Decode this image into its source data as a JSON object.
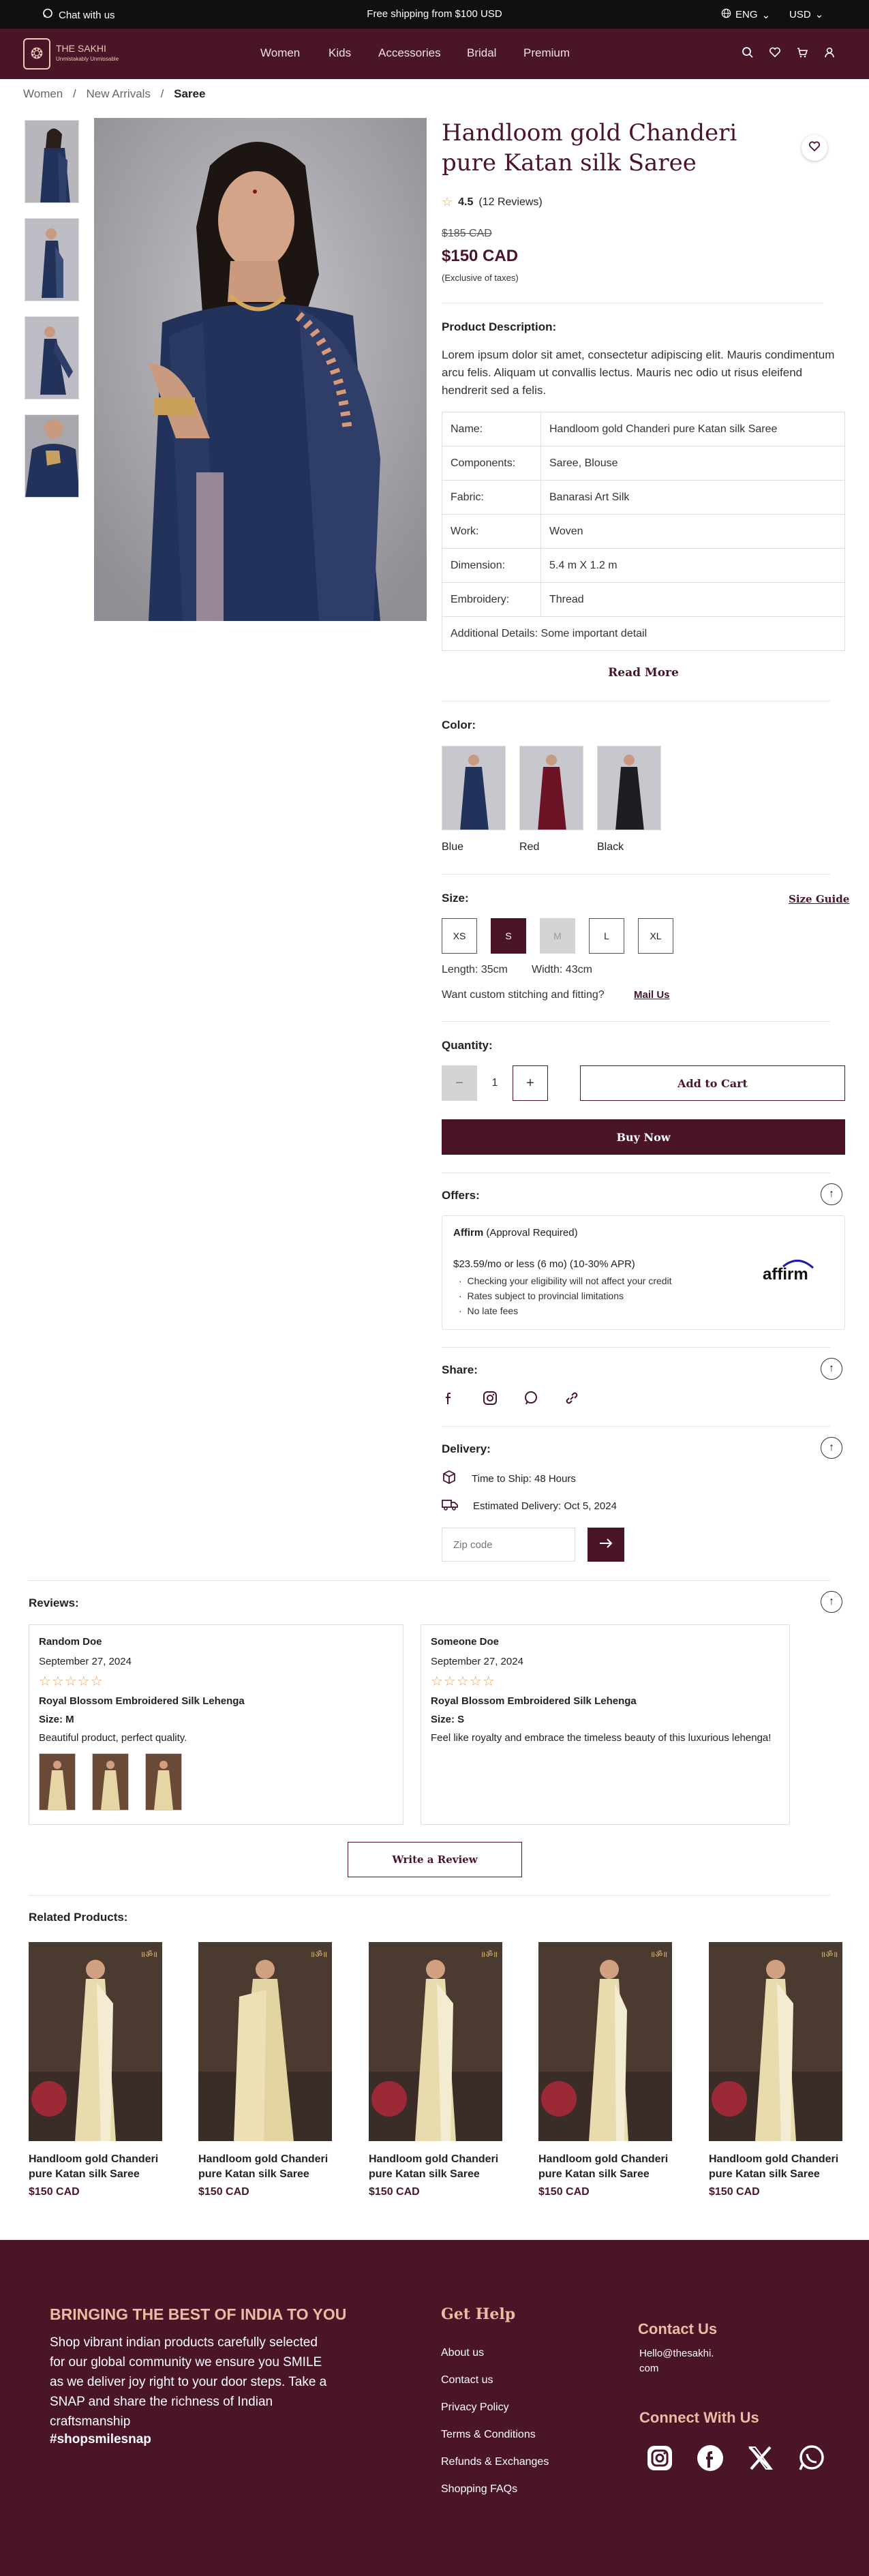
{
  "topbar": {
    "chat": "Chat with us",
    "shipping": "Free shipping from $100 USD",
    "language": "ENG",
    "currency": "USD"
  },
  "brand": {
    "name": "THE SAKHI",
    "tagline": "Unmistakably Unmissable"
  },
  "nav": {
    "items": [
      "Women",
      "Kids",
      "Accessories",
      "Bridal",
      "Premium"
    ]
  },
  "breadcrumb": [
    "Women",
    "New Arrivals",
    "Saree"
  ],
  "product": {
    "title": "Handloom gold Chanderi pure Katan silk Saree",
    "rating": "4.5",
    "reviews": "(12 Reviews)",
    "old_price": "$185 CAD",
    "price": "$150 CAD",
    "tax_note": "(Exclusive of taxes)",
    "desc_heading": "Product Description:",
    "description": "Lorem ipsum dolor sit amet, consectetur adipiscing elit. Mauris condimentum arcu felis. Aliquam ut convallis lectus. Mauris nec odio ut risus eleifend hendrerit sed a felis.",
    "specs": [
      {
        "k": "Name:",
        "v": "Handloom gold Chanderi pure Katan silk Saree"
      },
      {
        "k": "Components:",
        "v": "Saree, Blouse"
      },
      {
        "k": "Fabric:",
        "v": "Banarasi Art Silk"
      },
      {
        "k": "Work:",
        "v": "Woven"
      },
      {
        "k": "Dimension:",
        "v": "5.4 m X 1.2 m"
      },
      {
        "k": "Embroidery:",
        "v": "Thread"
      },
      {
        "k": "Additional Details:",
        "v": "Some important detail"
      }
    ],
    "read_more": "Read More",
    "color_label": "Color:",
    "colors": [
      {
        "name": "Blue",
        "hex": "#23325a"
      },
      {
        "name": "Red",
        "hex": "#6c1426"
      },
      {
        "name": "Black",
        "hex": "#1d1d22"
      }
    ],
    "size_label": "Size:",
    "size_guide": "Size Guide",
    "sizes": [
      "XS",
      "S",
      "M",
      "L",
      "XL"
    ],
    "selected_size": "S",
    "unavailable_size": "M",
    "length": "Length: 35cm",
    "width": "Width: 43cm",
    "stitch_q": "Want custom stitching and fitting?",
    "mail_us": "Mail Us",
    "qty_label": "Quantity:",
    "qty": "1",
    "qty_minus": "−",
    "qty_plus": "+",
    "add_to_cart": "Add to Cart",
    "buy_now": "Buy Now"
  },
  "offers": {
    "label": "Offers:",
    "brand": "Affirm",
    "approval": "(Approval Required)",
    "plan": "$23.59/mo or less (6 mo) (10-30% APR)",
    "points": [
      "Checking your eligibility will not affect your credit",
      "Rates subject to provincial limitations",
      "No late fees"
    ],
    "logo": "affirm"
  },
  "share": {
    "label": "Share:",
    "icons": [
      "facebook-icon",
      "instagram-icon",
      "whatsapp-icon",
      "link-icon"
    ]
  },
  "delivery": {
    "label": "Delivery:",
    "ship": "Time to Ship: 48 Hours",
    "estimate": "Estimated Delivery: Oct 5, 2024",
    "zip_placeholder": "Zip code"
  },
  "reviews": {
    "label": "Reviews:",
    "items": [
      {
        "name": "Random Doe",
        "date": "September 27, 2024",
        "product": "Royal Blossom Embroidered Silk Lehenga",
        "size": "Size: M",
        "text": "Beautiful product, perfect quality.",
        "stars": "☆☆☆☆☆"
      },
      {
        "name": "Someone Doe",
        "date": "September 27, 2024",
        "product": "Royal Blossom Embroidered Silk Lehenga",
        "size": "Size: S",
        "text": "Feel like royalty and embrace the timeless beauty of this luxurious lehenga!",
        "stars": "☆☆☆☆☆"
      }
    ],
    "write": "Write a Review"
  },
  "related": {
    "label": "Related Products:",
    "items": [
      {
        "name": "Handloom gold Chanderi pure Katan silk Saree",
        "price": "$150 CAD"
      },
      {
        "name": "Handloom gold Chanderi pure Katan silk Saree",
        "price": "$150 CAD"
      },
      {
        "name": "Handloom gold Chanderi pure Katan silk Saree",
        "price": "$150 CAD"
      },
      {
        "name": "Handloom gold Chanderi pure Katan silk Saree",
        "price": "$150 CAD"
      },
      {
        "name": "Handloom gold Chanderi pure Katan silk Saree",
        "price": "$150 CAD"
      }
    ]
  },
  "footer": {
    "headline": "BRINGING THE BEST  OF INDIA TO YOU",
    "about": "Shop vibrant indian products carefully selected for our global community we ensure you SMILE as we deliver joy right to your door steps. Take a SNAP and share the richness of Indian craftsmanship",
    "hashtag": "#shopsmilesnap",
    "help_title": "Get Help",
    "help_links": [
      "About us",
      "Contact us",
      "Privacy Policy",
      "Terms & Conditions",
      "Refunds & Exchanges",
      "Shopping FAQs"
    ],
    "contact_title": "Contact Us",
    "email": "Hello@thesakhi.com",
    "connect_title": "Connect With Us"
  },
  "colors": {
    "brand": "#4a1526",
    "accent": "#e8a25a",
    "footer_head": "#f0b9a3"
  }
}
